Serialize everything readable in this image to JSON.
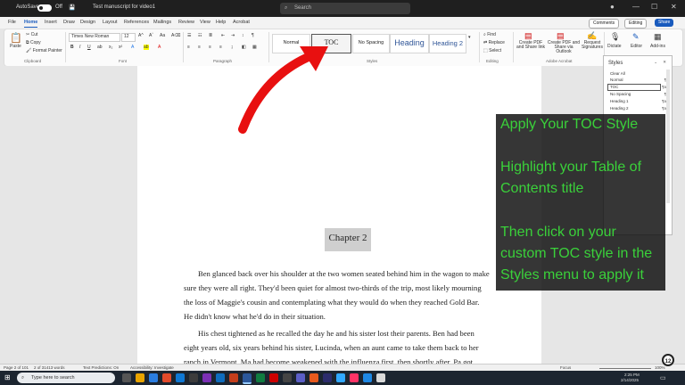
{
  "titlebar": {
    "autosave": "AutoSave",
    "toggle_state": "Off",
    "doc_name": "Test manuscript for video1",
    "search_placeholder": "Search"
  },
  "ribbon_tabs": [
    "File",
    "Home",
    "Insert",
    "Draw",
    "Design",
    "Layout",
    "References",
    "Mailings",
    "Review",
    "View",
    "Help",
    "Acrobat"
  ],
  "ribbon_actions": {
    "comments": "Comments",
    "editing": "Editing",
    "share": "Share"
  },
  "clipboard": {
    "paste": "Paste",
    "cut": "Cut",
    "copy": "Copy",
    "format_painter": "Format Painter",
    "label": "Clipboard"
  },
  "font": {
    "name": "Times New Roman",
    "size": "12",
    "bold": "B",
    "italic": "I",
    "underline": "U",
    "label": "Font"
  },
  "paragraph": {
    "label": "Paragraph"
  },
  "styles_gallery": {
    "normal": "Normal",
    "toc": "TOC",
    "no_spacing": "No Spacing",
    "heading": "Heading",
    "heading2": "Heading 2",
    "label": "Styles"
  },
  "editing": {
    "find": "Find",
    "replace": "Replace",
    "select": "Select",
    "label": "Editing"
  },
  "acrobat": {
    "create_pdf": "Create PDF and Share link",
    "create_pdf_outlook": "Create PDF and Share via Outlook",
    "request_signatures": "Request Signatures",
    "label": "Adobe Acrobat"
  },
  "voice": {
    "dictate": "Dictate",
    "editor": "Editor",
    "addins": "Add-ins"
  },
  "document": {
    "chapter": "Chapter 2",
    "lines": [
      "Ben glanced back over his shoulder at the two women seated behind him in the wagon to make",
      "sure they were all right. They'd been quiet for almost two-thirds of the trip, most likely mourning",
      "the loss of Maggie's cousin and contemplating what they would do when they reached Gold Bar.",
      "He didn't know what he'd do in their situation.",
      "His chest tightened as he recalled the day he and his sister lost their parents. Ben had been",
      "eight years old, six years behind his sister, Lucinda, when an aunt came to take them back to her",
      "ranch in Vermont. Ma had become weakened with the influenza first, then shortly after, Pa got"
    ]
  },
  "styles_pane": {
    "title": "Styles",
    "items": [
      {
        "name": "Clear All",
        "glyph": ""
      },
      {
        "name": "Normal",
        "glyph": "¶"
      },
      {
        "name": "TOC",
        "glyph": "¶a"
      },
      {
        "name": "No Spacing",
        "glyph": "¶"
      },
      {
        "name": "Heading 1",
        "glyph": "¶a"
      },
      {
        "name": "Heading 2",
        "glyph": "¶a"
      }
    ]
  },
  "overlay": {
    "lines": [
      "Apply Your TOC Style",
      "",
      "Highlight your Table of",
      "Contents title",
      "",
      "Then click on your",
      "custom TOC style in the",
      "Styles menu to apply it"
    ],
    "color": "#3ad13a"
  },
  "statusbar": {
    "page": "Page 2 of 101",
    "words": "2 of 31413 words",
    "predictions": "Text Predictions: On",
    "accessibility": "Accessibility: Investigate",
    "focus": "Focus",
    "zoom": "100%"
  },
  "taskbar": {
    "search_placeholder": "Type here to search",
    "time": "2:25 PM",
    "date": "2/14/2025",
    "badge": "12"
  },
  "colors": {
    "word_blue": "#185abd",
    "arrow_red": "#e81010",
    "overlay_text": "#3ad13a"
  }
}
